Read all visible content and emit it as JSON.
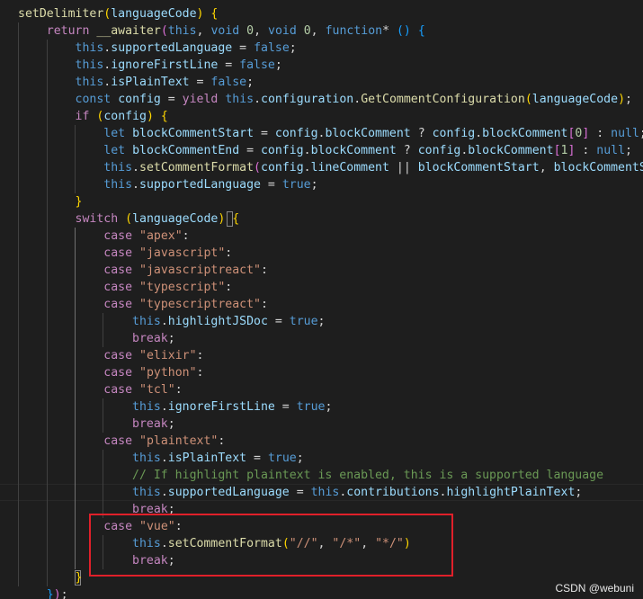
{
  "colors": {
    "background": "#1e1e1e",
    "highlight_box": "#e0202a",
    "keyword": "#569cd6",
    "control": "#c586c0",
    "function": "#dcdcaa",
    "variable": "#9cdcfe",
    "string": "#ce9178",
    "number": "#b5cea8",
    "comment": "#6a9955",
    "plain": "#d4d4d4",
    "bracket": "#ffd700"
  },
  "code": {
    "lines": [
      [
        [
          "setDelimiter",
          "fn"
        ],
        [
          "(",
          "br"
        ],
        [
          "languageCode",
          "v"
        ],
        [
          ") ",
          "br"
        ],
        [
          "{",
          "br"
        ]
      ],
      [
        [
          "    "
        ],
        [
          "return",
          "ctl"
        ],
        [
          " "
        ],
        [
          "__awaiter",
          "fn"
        ],
        [
          "(",
          "br2"
        ],
        [
          "this",
          "kw"
        ],
        [
          ", "
        ],
        [
          "void",
          "kw"
        ],
        [
          " "
        ],
        [
          "0",
          "num"
        ],
        [
          ", "
        ],
        [
          "void",
          "kw"
        ],
        [
          " "
        ],
        [
          "0",
          "num"
        ],
        [
          ", "
        ],
        [
          "function",
          "kw"
        ],
        [
          "* "
        ],
        [
          "()",
          "br3"
        ],
        [
          " "
        ],
        [
          "{",
          "br3"
        ]
      ],
      [
        [
          "        "
        ],
        [
          "this",
          "kw"
        ],
        [
          "."
        ],
        [
          "supportedLanguage",
          "v"
        ],
        [
          " = "
        ],
        [
          "false",
          "kw"
        ],
        [
          ";"
        ]
      ],
      [
        [
          "        "
        ],
        [
          "this",
          "kw"
        ],
        [
          "."
        ],
        [
          "ignoreFirstLine",
          "v"
        ],
        [
          " = "
        ],
        [
          "false",
          "kw"
        ],
        [
          ";"
        ]
      ],
      [
        [
          "        "
        ],
        [
          "this",
          "kw"
        ],
        [
          "."
        ],
        [
          "isPlainText",
          "v"
        ],
        [
          " = "
        ],
        [
          "false",
          "kw"
        ],
        [
          ";"
        ]
      ],
      [
        [
          "        "
        ],
        [
          "const",
          "kw"
        ],
        [
          " "
        ],
        [
          "config",
          "v"
        ],
        [
          " = "
        ],
        [
          "yield",
          "ctl"
        ],
        [
          " "
        ],
        [
          "this",
          "kw"
        ],
        [
          "."
        ],
        [
          "configuration",
          "v"
        ],
        [
          "."
        ],
        [
          "GetCommentConfiguration",
          "fn"
        ],
        [
          "(",
          "br"
        ],
        [
          "languageCode",
          "v"
        ],
        [
          ")",
          "br"
        ],
        [
          ";"
        ]
      ],
      [
        [
          "        "
        ],
        [
          "if",
          "ctl"
        ],
        [
          " "
        ],
        [
          "(",
          "br"
        ],
        [
          "config",
          "v"
        ],
        [
          ")",
          "br"
        ],
        [
          " "
        ],
        [
          "{",
          "br"
        ]
      ],
      [
        [
          "            "
        ],
        [
          "let",
          "kw"
        ],
        [
          " "
        ],
        [
          "blockCommentStart",
          "v"
        ],
        [
          " = "
        ],
        [
          "config",
          "v"
        ],
        [
          "."
        ],
        [
          "blockComment",
          "v"
        ],
        [
          " ? "
        ],
        [
          "config",
          "v"
        ],
        [
          "."
        ],
        [
          "blockComment",
          "v"
        ],
        [
          "[",
          "br2"
        ],
        [
          "0",
          "num"
        ],
        [
          "]",
          "br2"
        ],
        [
          " : "
        ],
        [
          "null",
          "kw"
        ],
        [
          ";"
        ]
      ],
      [
        [
          "            "
        ],
        [
          "let",
          "kw"
        ],
        [
          " "
        ],
        [
          "blockCommentEnd",
          "v"
        ],
        [
          " = "
        ],
        [
          "config",
          "v"
        ],
        [
          "."
        ],
        [
          "blockComment",
          "v"
        ],
        [
          " ? "
        ],
        [
          "config",
          "v"
        ],
        [
          "."
        ],
        [
          "blockComment",
          "v"
        ],
        [
          "[",
          "br2"
        ],
        [
          "1",
          "num"
        ],
        [
          "]",
          "br2"
        ],
        [
          " : "
        ],
        [
          "null",
          "kw"
        ],
        [
          ";"
        ]
      ],
      [
        [
          "            "
        ],
        [
          "this",
          "kw"
        ],
        [
          "."
        ],
        [
          "setCommentFormat",
          "fn"
        ],
        [
          "(",
          "br2"
        ],
        [
          "config",
          "v"
        ],
        [
          "."
        ],
        [
          "lineComment",
          "v"
        ],
        [
          " || "
        ],
        [
          "blockCommentStart",
          "v"
        ],
        [
          ", "
        ],
        [
          "blockCommentStart",
          "v"
        ]
      ],
      [
        [
          "            "
        ],
        [
          "this",
          "kw"
        ],
        [
          "."
        ],
        [
          "supportedLanguage",
          "v"
        ],
        [
          " = "
        ],
        [
          "true",
          "kw"
        ],
        [
          ";"
        ]
      ],
      [
        [
          "        "
        ],
        [
          "}",
          "br"
        ]
      ],
      [
        [
          "        "
        ],
        [
          "switch",
          "ctl"
        ],
        [
          " "
        ],
        [
          "(",
          "br"
        ],
        [
          "languageCode",
          "v"
        ],
        [
          ")",
          "br"
        ],
        [
          " "
        ],
        [
          "{",
          "br"
        ]
      ],
      [
        [
          "            "
        ],
        [
          "case",
          "ctl"
        ],
        [
          " "
        ],
        [
          "\"apex\"",
          "str"
        ],
        [
          ":"
        ]
      ],
      [
        [
          "            "
        ],
        [
          "case",
          "ctl"
        ],
        [
          " "
        ],
        [
          "\"javascript\"",
          "str"
        ],
        [
          ":"
        ]
      ],
      [
        [
          "            "
        ],
        [
          "case",
          "ctl"
        ],
        [
          " "
        ],
        [
          "\"javascriptreact\"",
          "str"
        ],
        [
          ":"
        ]
      ],
      [
        [
          "            "
        ],
        [
          "case",
          "ctl"
        ],
        [
          " "
        ],
        [
          "\"typescript\"",
          "str"
        ],
        [
          ":"
        ]
      ],
      [
        [
          "            "
        ],
        [
          "case",
          "ctl"
        ],
        [
          " "
        ],
        [
          "\"typescriptreact\"",
          "str"
        ],
        [
          ":"
        ]
      ],
      [
        [
          "                "
        ],
        [
          "this",
          "kw"
        ],
        [
          "."
        ],
        [
          "highlightJSDoc",
          "v"
        ],
        [
          " = "
        ],
        [
          "true",
          "kw"
        ],
        [
          ";"
        ]
      ],
      [
        [
          "                "
        ],
        [
          "break",
          "ctl"
        ],
        [
          ";"
        ]
      ],
      [
        [
          "            "
        ],
        [
          "case",
          "ctl"
        ],
        [
          " "
        ],
        [
          "\"elixir\"",
          "str"
        ],
        [
          ":"
        ]
      ],
      [
        [
          "            "
        ],
        [
          "case",
          "ctl"
        ],
        [
          " "
        ],
        [
          "\"python\"",
          "str"
        ],
        [
          ":"
        ]
      ],
      [
        [
          "            "
        ],
        [
          "case",
          "ctl"
        ],
        [
          " "
        ],
        [
          "\"tcl\"",
          "str"
        ],
        [
          ":"
        ]
      ],
      [
        [
          "                "
        ],
        [
          "this",
          "kw"
        ],
        [
          "."
        ],
        [
          "ignoreFirstLine",
          "v"
        ],
        [
          " = "
        ],
        [
          "true",
          "kw"
        ],
        [
          ";"
        ]
      ],
      [
        [
          "                "
        ],
        [
          "break",
          "ctl"
        ],
        [
          ";"
        ]
      ],
      [
        [
          "            "
        ],
        [
          "case",
          "ctl"
        ],
        [
          " "
        ],
        [
          "\"plaintext\"",
          "str"
        ],
        [
          ":"
        ]
      ],
      [
        [
          "                "
        ],
        [
          "this",
          "kw"
        ],
        [
          "."
        ],
        [
          "isPlainText",
          "v"
        ],
        [
          " = "
        ],
        [
          "true",
          "kw"
        ],
        [
          ";"
        ]
      ],
      [
        [
          "                "
        ],
        [
          "// If highlight plaintext is enabled, this is a supported language",
          "cm"
        ]
      ],
      [
        [
          "                "
        ],
        [
          "this",
          "kw"
        ],
        [
          "."
        ],
        [
          "supportedLanguage",
          "v"
        ],
        [
          " = "
        ],
        [
          "this",
          "kw"
        ],
        [
          "."
        ],
        [
          "contributions",
          "v"
        ],
        [
          "."
        ],
        [
          "highlightPlainText",
          "v"
        ],
        [
          ";"
        ]
      ],
      [
        [
          "                "
        ],
        [
          "break",
          "ctl"
        ],
        [
          ";"
        ]
      ],
      [
        [
          "            "
        ],
        [
          "case",
          "ctl"
        ],
        [
          " "
        ],
        [
          "\"vue\"",
          "str"
        ],
        [
          ":"
        ]
      ],
      [
        [
          "                "
        ],
        [
          "this",
          "kw"
        ],
        [
          "."
        ],
        [
          "setCommentFormat",
          "fn"
        ],
        [
          "(",
          "br"
        ],
        [
          "\"//\"",
          "str"
        ],
        [
          ", "
        ],
        [
          "\"/*\"",
          "str"
        ],
        [
          ", "
        ],
        [
          "\"*/\"",
          "str"
        ],
        [
          ")",
          "br"
        ]
      ],
      [
        [
          "                "
        ],
        [
          "break",
          "ctl"
        ],
        [
          ";"
        ]
      ],
      [
        [
          "        "
        ],
        [
          "}",
          "br"
        ]
      ],
      [
        [
          "    "
        ],
        [
          "}",
          "br3"
        ],
        [
          ")",
          "br2"
        ],
        [
          ";"
        ]
      ]
    ]
  },
  "watermark": "CSDN @webuni"
}
